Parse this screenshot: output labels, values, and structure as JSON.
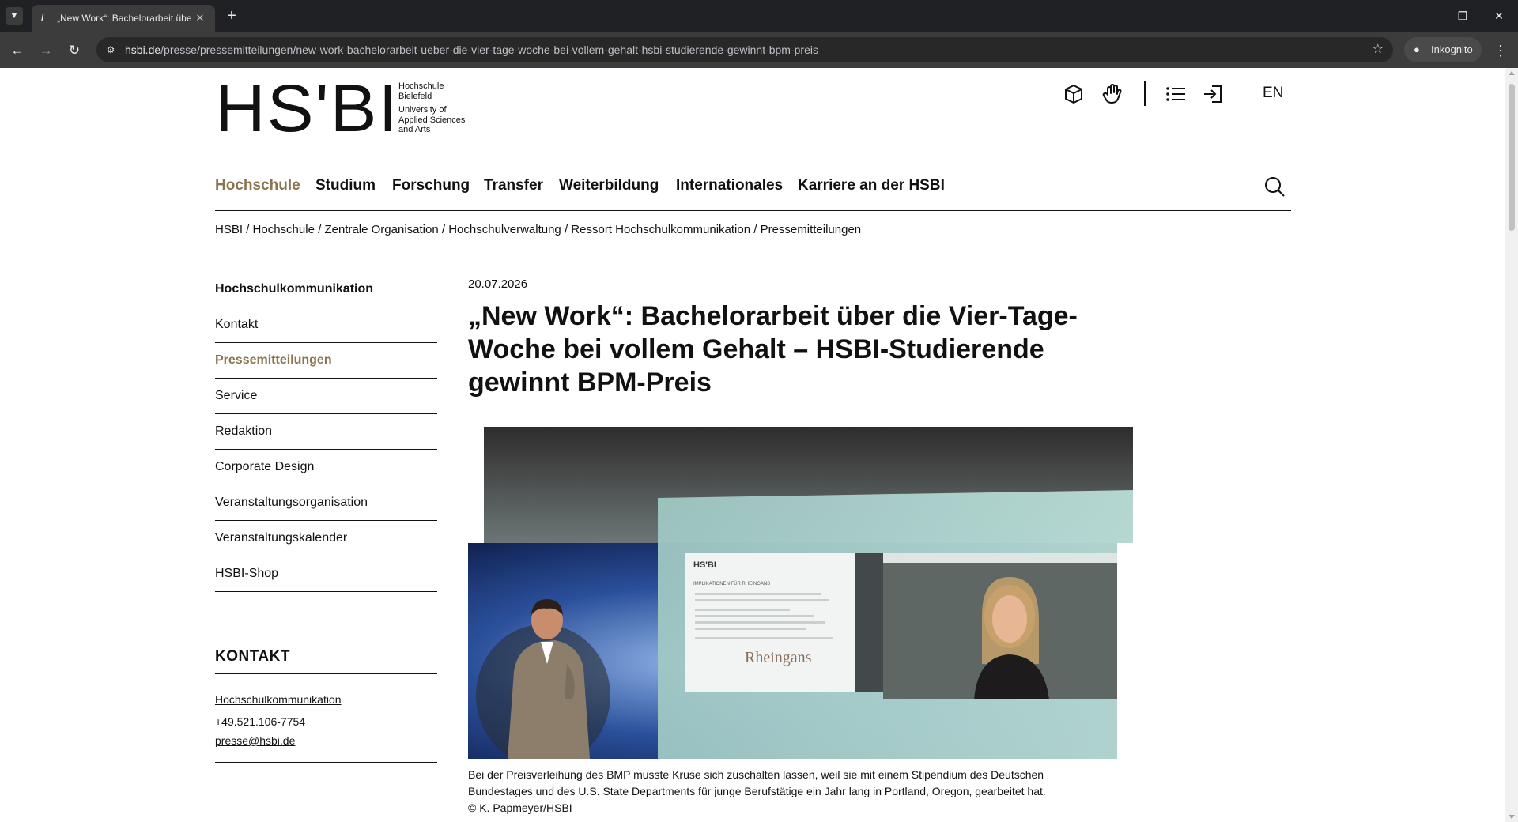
{
  "browser": {
    "tab_title": "„New Work“: Bachelorarbeit über die Vier-Tage-Woche",
    "tab_close": "✕",
    "new_tab": "+",
    "url_domain": "hsbi.de",
    "url_path": "/presse/pressemitteilungen/new-work-bachelorarbeit-ueber-die-vier-tage-woche-bei-vollem-gehalt-hsbi-studierende-gewinnt-bpm-preis",
    "profile_label": "Inkognito",
    "icons": [
      "tab-search-icon",
      "favicon-icon",
      "back-icon",
      "forward-icon",
      "reload-icon",
      "site-info-icon",
      "bookmark-star-icon",
      "incognito-icon",
      "menu-kebab-icon",
      "minimize-icon",
      "restore-icon",
      "close-icon"
    ]
  },
  "header": {
    "logo_mark": "HS'BI",
    "logo_lines": [
      "Hochschule",
      "Bielefeld",
      "University of",
      "Applied Sciences",
      "and Arts"
    ],
    "icons": [
      "sign-language-cube-icon",
      "hand-icon",
      "list-icon",
      "login-icon"
    ],
    "lang": "EN"
  },
  "mainnav": {
    "items": [
      "Hochschule",
      "Studium",
      "Forschung",
      "Transfer",
      "Weiterbildung",
      "Internationales",
      "Karriere an der HSBI"
    ],
    "active": "Hochschule"
  },
  "breadcrumb": [
    "HSBI",
    "Hochschule",
    "Zentrale Organisation",
    "Hochschulverwaltung",
    "Ressort Hochschulkommunikation",
    "Pressemitteilungen"
  ],
  "breadcrumb_sep": " / ",
  "sidebar": {
    "title": "Hochschulkommunikation",
    "items": [
      "Kontakt",
      "Pressemitteilungen",
      "Service",
      "Redaktion",
      "Corporate Design",
      "Veranstaltungsorganisation",
      "Veranstaltungskalender",
      "HSBI-Shop"
    ],
    "active": "Pressemitteilungen"
  },
  "contact": {
    "title": "KONTAKT",
    "name": "Hochschulkommunikation",
    "phone": "+49.521.106-7754",
    "email": "presse@hsbi.de"
  },
  "article": {
    "date": "20.07.2026",
    "headline": "„New Work“: Bachelorarbeit über die Vier-Tage-Woche bei vollem Gehalt – HSBI-Studierende gewinnt BPM-Preis",
    "image_slide_logo": "HS'BI",
    "image_slide_heading": "IMPLIKATIONEN FÜR RHEINGANS",
    "image_slide_brand": "Rheingans",
    "caption": "Bei der Preisverleihung des BMP musste Kruse sich zuschalten lassen, weil sie mit einem Stipendium des Deutschen Bundestages und des U.S. State Departments für junge Berufstätige ein Jahr lang in Portland, Oregon, gearbeitet hat. © K. Papmeyer/HSBI"
  },
  "colors": {
    "accent": "#8b7550",
    "text": "#111111",
    "chrome_dark": "#202124",
    "chrome_toolbar": "#3c3c3c"
  }
}
